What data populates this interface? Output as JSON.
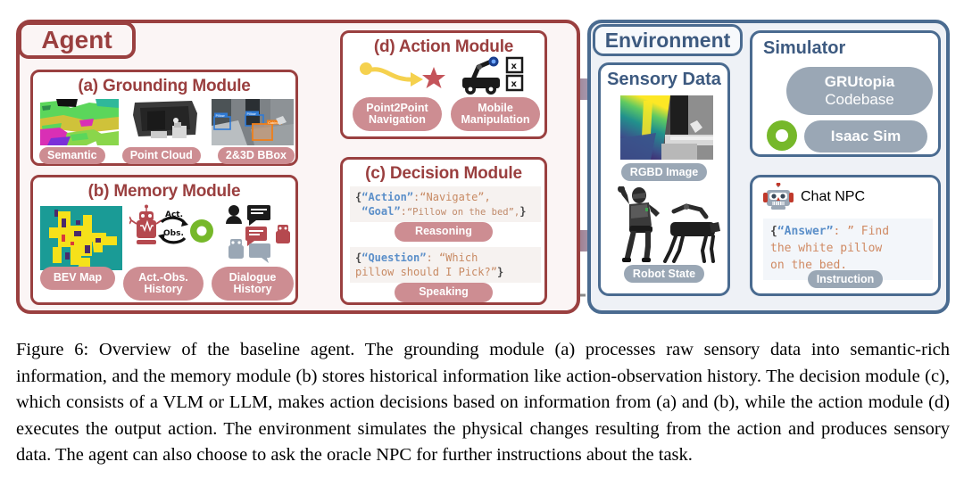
{
  "figure": {
    "caption": "Figure 6: Overview of the baseline agent. The grounding module (a) processes raw sensory data into semantic-rich information, and the memory module (b) stores historical information like action-observation history. The decision module (c), which consists of a VLM or LLM, makes action decisions based on information from (a) and (b), while the action module (d) executes the output action. The environment simulates the physical changes resulting from the action and produces sensory data. The agent can also choose to ask the oracle NPC for further instructions about the task."
  },
  "colors": {
    "agent_red": "#9a4040",
    "agent_title_red": "#9a3f3f",
    "agent_bg": "#fbf5f5",
    "env_blue": "#4a6b90",
    "env_title_blue": "#3d5a80",
    "env_bg": "#eef1f6",
    "pill_red": "#cd8d92",
    "pill_gray": "#9aa7b5",
    "arrow_gray": "#808080",
    "green": "#76b82a",
    "yellow": "#f5d14e"
  },
  "agent": {
    "title": "Agent",
    "grounding": {
      "title": "(a) Grounding Module",
      "items": [
        {
          "label": "Semantic",
          "icon": "semantic-segmentation-thumbnail"
        },
        {
          "label": "Point Cloud",
          "icon": "point-cloud-thumbnail"
        },
        {
          "label": "2&3D BBox",
          "icon": "bounding-box-thumbnail"
        }
      ],
      "bbox_labels": [
        "Pillow",
        "Pillow",
        "Cabinet"
      ]
    },
    "memory": {
      "title": "(b) Memory Module",
      "items": [
        {
          "label": "BEV Map",
          "icon": "bev-map-thumbnail"
        },
        {
          "label": "Act.-Obs. History",
          "label_l1": "Act.-Obs.",
          "label_l2": "History",
          "icon": "act-obs-cycle-icon"
        },
        {
          "label": "Dialogue History",
          "label_l1": "Dialogue",
          "label_l2": "History",
          "icon": "dialogue-bubbles-icon"
        }
      ],
      "cycle_labels": {
        "act": "Act.",
        "obs": "Obs."
      }
    },
    "decision": {
      "title": "(c) Decision Module",
      "blocks": [
        {
          "code_line1_open": "{",
          "code_line1_key": "“Action”",
          "code_line1_colon": ":",
          "code_line1_val": "“Navigate”,",
          "code_line2_key": "“Goal”",
          "code_line2_colon": ":",
          "code_line2_val": "“Pillow on the bed”,",
          "code_line2_close": "}",
          "pill": "Reasoning"
        },
        {
          "code_line1_open": "{",
          "code_line1_key": "“Question”",
          "code_line1_colon": ":",
          "code_line1_val": "“Which",
          "code_line2_val": "pillow should I Pick?”",
          "code_line2_close": "}",
          "pill": "Speaking"
        }
      ]
    },
    "action": {
      "title": "(d) Action Module",
      "items": [
        {
          "label": "Point2Point Navigation",
          "label_l1": "Point2Point",
          "label_l2": "Navigation",
          "icon": "path-to-star-icon"
        },
        {
          "label": "Mobile Manipulation",
          "label_l1": "Mobile",
          "label_l2": "Manipulation",
          "icon": "mobile-manipulator-icon"
        }
      ]
    }
  },
  "environment": {
    "title": "Environment",
    "sensory": {
      "title": "Sensory Data",
      "items": [
        {
          "label": "RGBD Image",
          "icon": "rgbd-depth-thumbnail"
        },
        {
          "label": "Robot State",
          "icon": "humanoid-and-quadruped-icon"
        }
      ]
    },
    "simulator": {
      "title": "Simulator",
      "items": [
        {
          "label": "GRUtopia Codebase",
          "label_l1": "GRUtopia",
          "label_l2": "Codebase"
        },
        {
          "label": "Isaac Sim"
        }
      ],
      "logo": "nvidia-omniverse-green-ring-icon"
    },
    "npc": {
      "title": "Chat NPC",
      "icon": "robot-head-icon",
      "code_open": "{",
      "code_key": "“Answer”",
      "code_colon": ":",
      "code_line1": "” Find",
      "code_line2": "the white pillow",
      "code_line3": "on the bed.",
      "pill": "Instruction"
    }
  },
  "arrows": {
    "action_to_env": "action-output-arrow-left",
    "env_to_decision": "sensory-feedback-arrow-right",
    "npc_dialogue": "npc-dialogue-dashed-arrow",
    "grounding_to_decision": "grounding-to-decision-arrow",
    "memory_to_decision": "memory-to-decision-arrow",
    "decision_to_action": "decision-to-action-arrow",
    "simulator_to_sensory": "simulator-to-sensory-arrow"
  }
}
